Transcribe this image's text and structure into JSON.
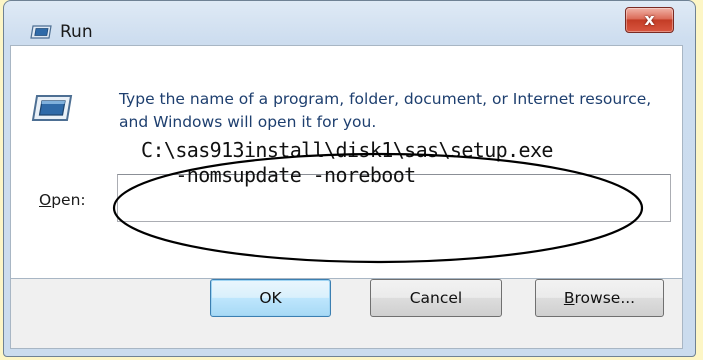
{
  "window": {
    "title": "Run",
    "close_glyph": "x"
  },
  "dialog": {
    "description": "Type the name of a program, folder, document, or Internet resource, and Windows will open it for you.",
    "open_label_mnemonic": "O",
    "open_label_rest": "pen:",
    "open_value_line1": "C:\\sas913install\\disk1\\sas\\setup.exe",
    "open_value_line2": "   -nomsupdate -noreboot"
  },
  "buttons": {
    "ok": "OK",
    "cancel": "Cancel",
    "browse_mnemonic": "B",
    "browse_rest": "rowse..."
  },
  "colors": {
    "page_background": "#fdf6c6",
    "description_text": "#1e3f6f",
    "close_button": "#c33c26",
    "default_button_border": "#3c7fb1"
  },
  "icons": {
    "title_icon": "run-icon",
    "app_icon": "run-icon",
    "close_icon": "close-icon"
  }
}
